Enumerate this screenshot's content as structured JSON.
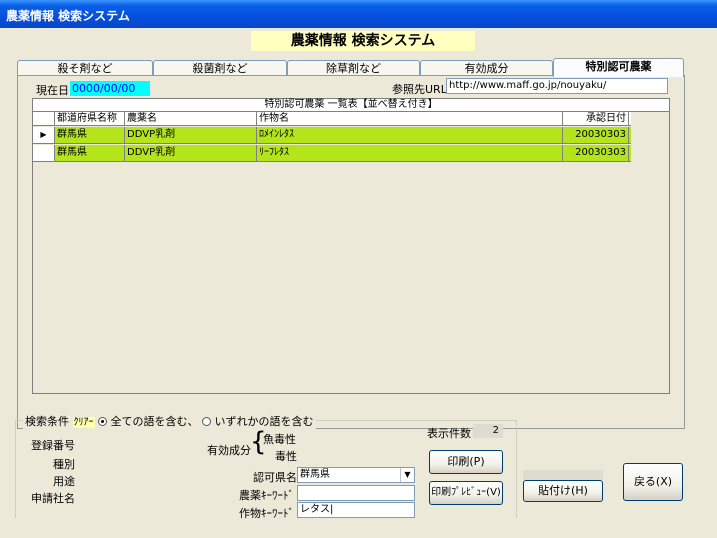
{
  "window": {
    "title": "農薬情報  検索システム"
  },
  "header": {
    "banner": "農薬情報  検索システム"
  },
  "tabs": [
    {
      "label": "殺そ剤など"
    },
    {
      "label": "殺菌剤など"
    },
    {
      "label": "除草剤など"
    },
    {
      "label": "有効成分"
    },
    {
      "label": "特別認可農薬"
    }
  ],
  "panel": {
    "date_label": "現在日",
    "date_value": "0000/00/00",
    "url_label": "参照先URL",
    "url_value": "http://www.maff.go.jp/nouyaku/"
  },
  "grid": {
    "caption": "特別認可農薬  一覧表【並べ替え付き】",
    "columns": [
      "都道府県名称",
      "農薬名",
      "作物名",
      "承認日付"
    ],
    "rows": [
      {
        "pref": "群馬県",
        "pesticide": "DDVP乳剤",
        "crop": "ﾛﾒｲﾝﾚﾀｽ",
        "date": "20030303"
      },
      {
        "pref": "群馬県",
        "pesticide": "DDVP乳剤",
        "crop": "ﾘｰﾌﾚﾀｽ",
        "date": "20030303"
      }
    ]
  },
  "search": {
    "group_label": "検索条件",
    "clear_label": "ｸﾘｱｰ",
    "radio_all": "全ての語を含む、",
    "radio_any": "いずれかの語を含む",
    "reg_no_label": "登録番号",
    "type_label": "種別",
    "use_label": "用途",
    "applicant_label": "申請社名",
    "active_label": "有効成分",
    "fish_toxicity": "魚毒性",
    "toxicity": "毒性",
    "count_label": "表示件数",
    "count_value": "2",
    "pref_label": "認可県名",
    "pref_value": "群馬県",
    "keyword_label": "農薬ｷｰﾜｰﾄﾞ",
    "keyword_value": "",
    "crop_kw_label": "作物ｷｰﾜｰﾄﾞ",
    "crop_kw_value": "レタス|"
  },
  "buttons": {
    "print": "印刷(P)",
    "preview": "印刷ﾌﾟﾚﾋﾞｭｰ(V)",
    "paste": "貼付け(H)",
    "back": "戻る(X)"
  },
  "colors": {
    "row_highlight": "#b4e41a",
    "date_bg": "#00ffff",
    "banner_bg": "#ffffc0"
  }
}
